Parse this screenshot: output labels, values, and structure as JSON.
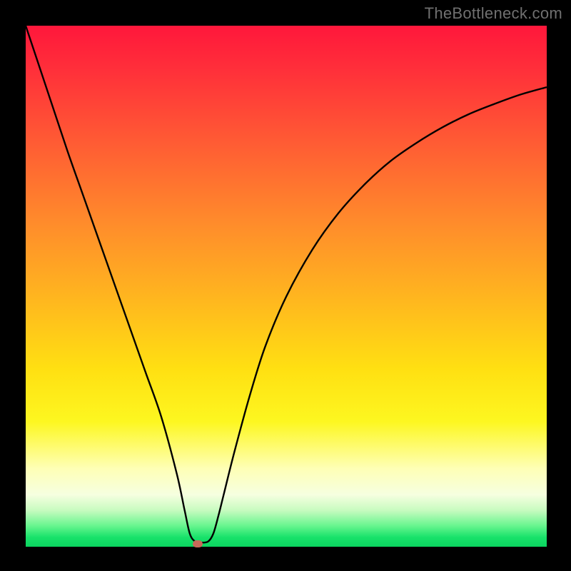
{
  "attribution": "TheBottleneck.com",
  "colors": {
    "frame": "#000000",
    "gradient_top": "#ff173b",
    "gradient_mid": "#ffe012",
    "gradient_bottom": "#0bd45f",
    "curve": "#000000",
    "marker": "#c76a5a"
  },
  "chart_data": {
    "type": "line",
    "title": "",
    "xlabel": "",
    "ylabel": "",
    "xlim": [
      0,
      100
    ],
    "ylim": [
      0,
      100
    ],
    "grid": false,
    "legend": false,
    "annotations": [],
    "x": [
      0,
      2,
      5,
      8,
      11,
      14,
      17,
      20,
      23,
      26,
      29,
      30.5,
      31.5,
      32.5,
      33.5,
      35,
      36,
      37,
      38,
      40,
      43,
      46,
      50,
      55,
      60,
      65,
      70,
      75,
      80,
      85,
      90,
      95,
      100
    ],
    "values": [
      100,
      94,
      85,
      76,
      67.5,
      59,
      50.5,
      42,
      33.5,
      25,
      14,
      7,
      2.5,
      1.0,
      0.8,
      1.0,
      2.5,
      6,
      10,
      18,
      29,
      38.5,
      48,
      57,
      64,
      69.5,
      74,
      77.5,
      80.5,
      83,
      85,
      86.8,
      88.2
    ],
    "marker": {
      "x": 33,
      "y": 0.5
    }
  }
}
